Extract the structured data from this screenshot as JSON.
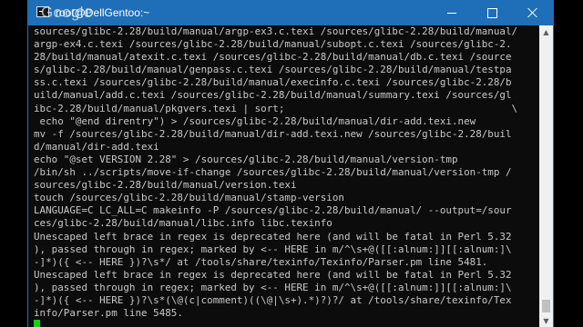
{
  "window": {
    "title": "root@DellGentoo:~",
    "overlay_text": "Google",
    "controls": {
      "minimize": "minimize",
      "maximize": "maximize",
      "close": "close"
    }
  },
  "terminal": {
    "lines": [
      "sources/glibc-2.28/build/manual/argp-ex3.c.texi /sources/glibc-2.28/build/manual/",
      "argp-ex4.c.texi /sources/glibc-2.28/build/manual/subopt.c.texi /sources/glibc-2.",
      "28/build/manual/atexit.c.texi /sources/glibc-2.28/build/manual/db.c.texi /source",
      "s/glibc-2.28/build/manual/genpass.c.texi /sources/glibc-2.28/build/manual/testpa",
      "ss.c.texi /sources/glibc-2.28/build/manual/execinfo.c.texi /sources/glibc-2.28/b",
      "uild/manual/add.c.texi /sources/glibc-2.28/build/manual/summary.texi /sources/gl",
      "ibc-2.28/build/manual/pkgvers.texi | sort;                                      \\",
      " echo \"@end direntry\") > /sources/glibc-2.28/build/manual/dir-add.texi.new",
      "mv -f /sources/glibc-2.28/build/manual/dir-add.texi.new /sources/glibc-2.28/buil",
      "d/manual/dir-add.texi",
      "echo \"@set VERSION 2.28\" > /sources/glibc-2.28/build/manual/version-tmp",
      "/bin/sh ../scripts/move-if-change /sources/glibc-2.28/build/manual/version-tmp /",
      "sources/glibc-2.28/build/manual/version.texi",
      "touch /sources/glibc-2.28/build/manual/stamp-version",
      "LANGUAGE=C LC_ALL=C makeinfo -P /sources/glibc-2.28/build/manual/ --output=/sour",
      "ces/glibc-2.28/build/manual/libc.info libc.texinfo",
      "Unescaped left brace in regex is deprecated here (and will be fatal in Perl 5.32",
      "), passed through in regex; marked by <-- HERE in m/^\\s+@([[:alnum:]][[:alnum:]\\",
      "-]*)({ <-- HERE })?\\s*/ at /tools/share/texinfo/Texinfo/Parser.pm line 5481.",
      "Unescaped left brace in regex is deprecated here (and will be fatal in Perl 5.32",
      "), passed through in regex; marked by <-- HERE in m/^\\s+@([[:alnum:]][[:alnum:]\\",
      "-]*)({ <-- HERE })?\\s*(\\@(c|comment)((\\@|\\s+).*)?)?/ at /tools/share/texinfo/Tex",
      "info/Parser.pm line 5485."
    ]
  },
  "colors": {
    "titlebar": "#1e6fb8",
    "terminal_bg": "#0c0c0c",
    "terminal_fg": "#c8c8c8",
    "cursor": "#13d313"
  }
}
